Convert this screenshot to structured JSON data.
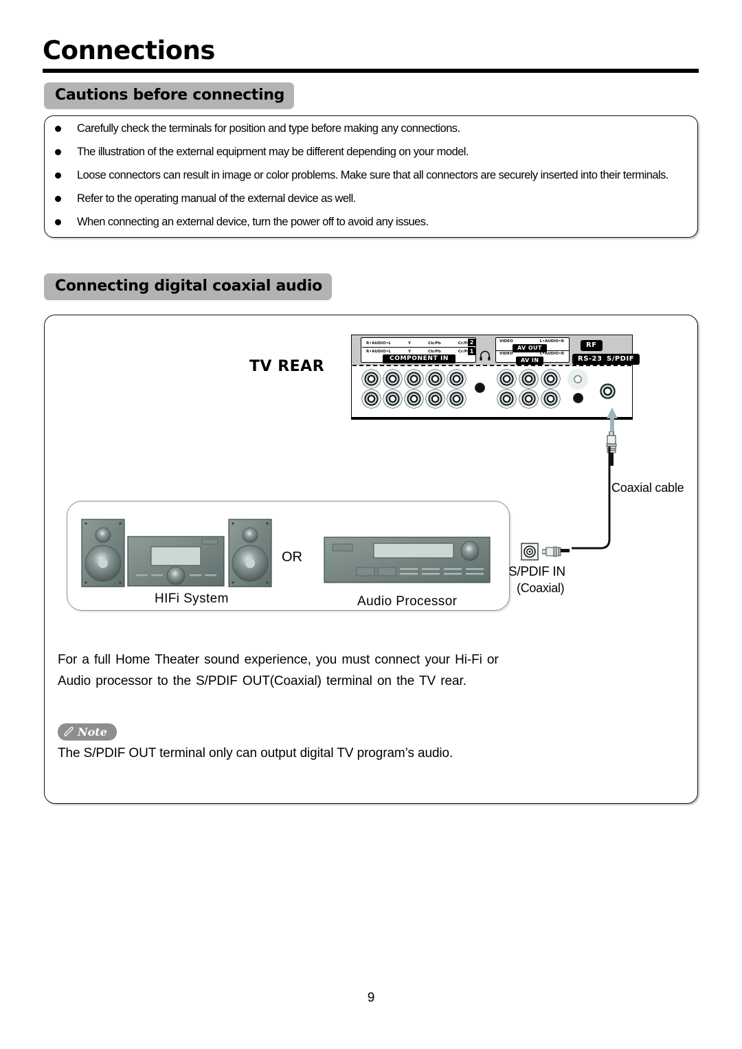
{
  "page": {
    "title": "Connections",
    "number": "9"
  },
  "sections": {
    "cautions": {
      "header": "Cautions before connecting",
      "bullets": [
        "Carefully check the terminals for position and type before making any connections.",
        "The illustration of the external equipment may be different depending on your model.",
        "Loose connectors can result in image or color problems. Make sure that all connectors are securely inserted into their terminals.",
        "Refer to the operating manual of the external device as well.",
        "When connecting an external device, turn the power off to avoid any issues."
      ]
    },
    "coaxial": {
      "header": "Connecting digital coaxial audio",
      "tv_rear_label": "TV REAR",
      "tv_panel": {
        "component": {
          "group_tag": "COMPONENT IN",
          "row2": {
            "badge": "2",
            "cells": [
              "R•AUDIO•L",
              "Y",
              "Cb/Pb",
              "Cr/Pr"
            ]
          },
          "row1": {
            "badge": "1",
            "cells": [
              "R•AUDIO•L",
              "Y",
              "Cb/Pb",
              "Cr/Pr"
            ]
          }
        },
        "av": {
          "out": {
            "tag": "AV OUT",
            "cells": [
              "VIDEO",
              "L•AUDIO•R"
            ]
          },
          "in": {
            "tag": "AV IN",
            "cells": [
              "VIDEO",
              "L•AUDIO•R"
            ]
          }
        },
        "tags": {
          "rf": "RF",
          "rs232": "RS-232",
          "spdif": "S/PDIF"
        },
        "headphone_icon": "headphone-icon"
      },
      "cable_label": "Coaxial cable",
      "spdif_in": {
        "label": "S/PDIF IN",
        "sublabel": "(Coaxial)"
      },
      "equipment": {
        "hifi_label": "HIFi  System",
        "or_label": "OR",
        "processor_label": "Audio  Processor"
      },
      "body": [
        "For a full Home Theater sound experience, you must connect your Hi-Fi or",
        "Audio processor to the S/PDIF OUT(Coaxial) terminal on the TV rear."
      ],
      "note": {
        "badge": "Note",
        "text": "The S/PDIF OUT terminal only can output digital TV program’s audio."
      }
    }
  },
  "colors": {
    "header_pill": "#b3b3b3",
    "note_badge": "#8e8e8e",
    "panel_gray": "#c9c9c9",
    "equipment_body": "#6f7e7e"
  }
}
